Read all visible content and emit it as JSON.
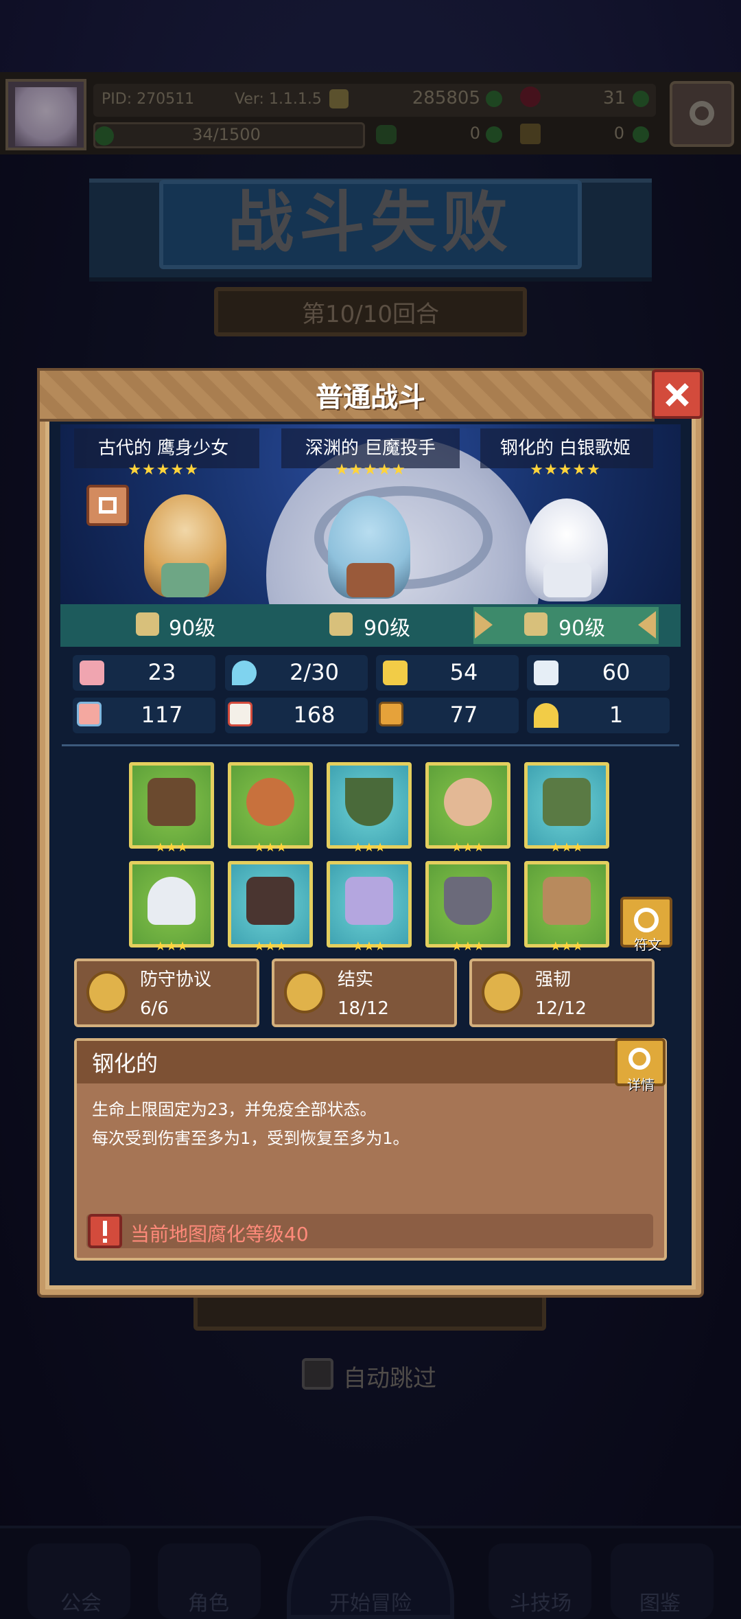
{
  "header": {
    "pid": "PID: 270511",
    "version": "Ver: 1.1.1.5",
    "gold": "285805",
    "gems": "31",
    "stamina": "34/1500",
    "clovers": "0",
    "boots": "0"
  },
  "battle": {
    "result_title": "战斗失败",
    "round": "第10/10回合",
    "auto_skip_label": "自动跳过"
  },
  "modal": {
    "title": "普通战斗",
    "heroes": [
      {
        "name": "古代的 鹰身少女",
        "stars": "★★★★★",
        "level": "90级"
      },
      {
        "name": "深渊的 巨魔投手",
        "stars": "★★★★★",
        "level": "90级"
      },
      {
        "name": "钢化的 白银歌姬",
        "stars": "★★★★★",
        "level": "90级"
      }
    ],
    "stats": {
      "hp": "23",
      "mana": "2/30",
      "defense": "54",
      "speed": "60",
      "attack": "117",
      "magic": "168",
      "resist": "77",
      "luck": "1"
    },
    "rune_label": "符文",
    "sets": [
      {
        "name": "防守协议",
        "count": "6/6"
      },
      {
        "name": "结实",
        "count": "18/12"
      },
      {
        "name": "强韧",
        "count": "12/12"
      }
    ],
    "trait": {
      "title": "钢化的",
      "detail_label": "详情",
      "line1": "生命上限固定为23，并免疫全部状态。",
      "line2": "每次受到伤害至多为1，受到恢复至多为1。",
      "warning": "当前地图腐化等级40"
    },
    "equipment_stars": "★★★"
  },
  "nav": {
    "guild": "公会",
    "characters": "角色",
    "start": "开始冒险",
    "arena": "斗技场",
    "codex": "图鉴"
  },
  "icons": [
    "settings-gear-icon",
    "close-icon",
    "lock-icon",
    "heart-icon",
    "water-drop-icon",
    "shield-icon",
    "wing-icon",
    "fist-icon",
    "book-icon",
    "resist-icon",
    "horseshoe-icon",
    "refresh-icon",
    "magnifier-icon",
    "warning-icon"
  ]
}
